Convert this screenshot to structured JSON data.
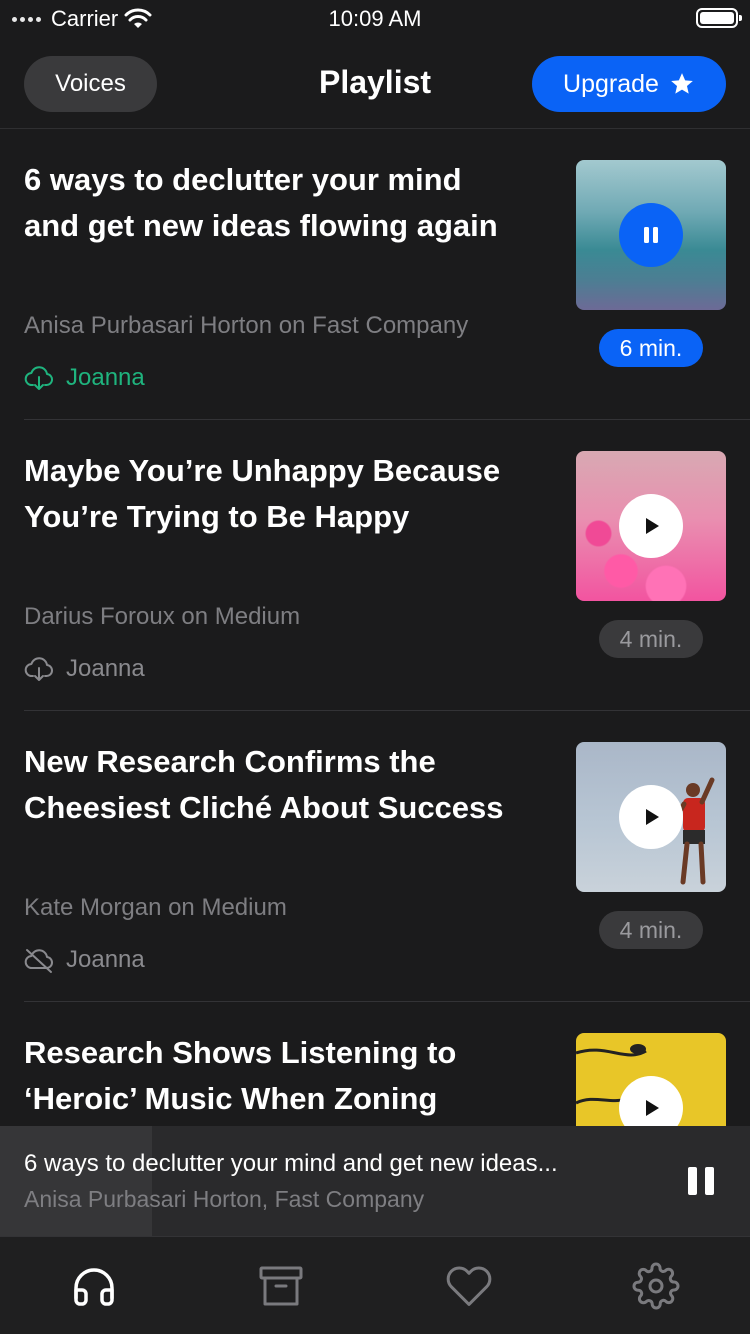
{
  "status": {
    "carrier": "Carrier",
    "time": "10:09 AM"
  },
  "header": {
    "voices_label": "Voices",
    "title": "Playlist",
    "upgrade_label": "Upgrade"
  },
  "articles": [
    {
      "title": "6 ways to declutter your mind and get new ideas flowing again",
      "source": "Anisa Purbasari Horton on Fast Company",
      "voice": "Joanna",
      "voice_icon": "download-cloud-icon",
      "duration": "6 min.",
      "state": "playing"
    },
    {
      "title": "Maybe You’re Unhappy Because You’re Trying to Be Happy",
      "source": "Darius Foroux on Medium",
      "voice": "Joanna",
      "voice_icon": "download-cloud-icon",
      "duration": "4 min.",
      "state": "paused"
    },
    {
      "title": "New Research Confirms the Cheesiest Cliché About Success",
      "source": "Kate Morgan on Medium",
      "voice": "Joanna",
      "voice_icon": "cloud-off-icon",
      "duration": "4 min.",
      "state": "paused"
    },
    {
      "title": "Research Shows Listening to ‘Heroic’ Music When Zoning",
      "state": "paused"
    }
  ],
  "mini_player": {
    "title": "6 ways to declutter your mind and get new ideas...",
    "subtitle": "Anisa Purbasari Horton, Fast Company"
  },
  "tabs": [
    {
      "icon": "headphones-icon",
      "active": true
    },
    {
      "icon": "archive-icon",
      "active": false
    },
    {
      "icon": "heart-icon",
      "active": false
    },
    {
      "icon": "gear-icon",
      "active": false
    }
  ],
  "colors": {
    "background": "#1b1b1c",
    "accent": "#0a63f6",
    "downloaded": "#1fb47e",
    "muted": "#7e7e82"
  }
}
